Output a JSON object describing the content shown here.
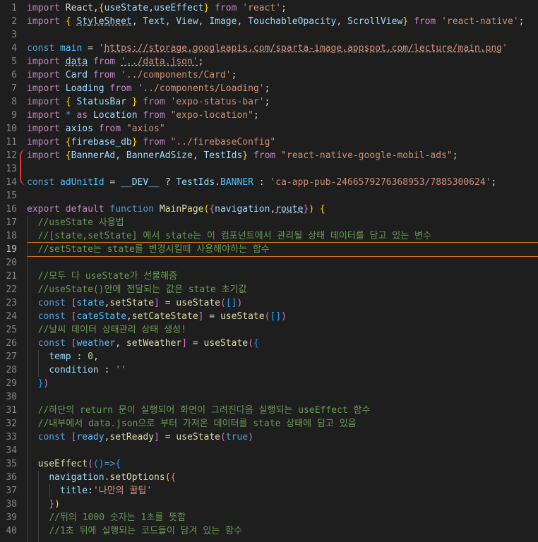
{
  "editor": {
    "current_line": 19,
    "colors": {
      "background": "#1e1e1e",
      "current_line_border": "#d8761c",
      "diff_marker": "#e0393e"
    },
    "lines": [
      {
        "n": 1,
        "t": [
          [
            "kw",
            "import"
          ],
          [
            "p",
            " React,"
          ],
          [
            "b1",
            "{"
          ],
          [
            "var",
            "useState"
          ],
          [
            "p",
            ","
          ],
          [
            "var",
            "useEffect"
          ],
          [
            "b1",
            "}"
          ],
          [
            "p",
            " "
          ],
          [
            "kw",
            "from"
          ],
          [
            "p",
            " "
          ],
          [
            "str",
            "'react'"
          ],
          [
            "p",
            ";"
          ]
        ]
      },
      {
        "n": 2,
        "t": [
          [
            "kw",
            "import"
          ],
          [
            "p",
            " "
          ],
          [
            "b1",
            "{"
          ],
          [
            "p",
            " "
          ],
          [
            "varu",
            "StyleSheet"
          ],
          [
            "p",
            ", "
          ],
          [
            "var",
            "Text"
          ],
          [
            "p",
            ", "
          ],
          [
            "var",
            "View"
          ],
          [
            "p",
            ", "
          ],
          [
            "var",
            "Image"
          ],
          [
            "p",
            ", "
          ],
          [
            "var",
            "TouchableOpacity"
          ],
          [
            "p",
            ", "
          ],
          [
            "var",
            "ScrollView"
          ],
          [
            "b1",
            "}"
          ],
          [
            "p",
            " "
          ],
          [
            "kw",
            "from"
          ],
          [
            "p",
            " "
          ],
          [
            "str",
            "'react-native'"
          ],
          [
            "p",
            ";"
          ]
        ]
      },
      {
        "n": 3,
        "t": []
      },
      {
        "n": 4,
        "t": [
          [
            "kw2",
            "const"
          ],
          [
            "p",
            " "
          ],
          [
            "const",
            "main"
          ],
          [
            "p",
            " = "
          ],
          [
            "str",
            "'"
          ],
          [
            "stru",
            "https://storage.googleapis.com/sparta-image.appspot.com/lecture/main.png"
          ],
          [
            "str",
            "'"
          ]
        ]
      },
      {
        "n": 5,
        "t": [
          [
            "kw",
            "import"
          ],
          [
            "p",
            " "
          ],
          [
            "varu",
            "data"
          ],
          [
            "p",
            " "
          ],
          [
            "kw",
            "from"
          ],
          [
            "p",
            " "
          ],
          [
            "stru",
            "'../data.json'"
          ],
          [
            "p",
            ";"
          ]
        ]
      },
      {
        "n": 6,
        "t": [
          [
            "kw",
            "import"
          ],
          [
            "p",
            " "
          ],
          [
            "var",
            "Card"
          ],
          [
            "p",
            " "
          ],
          [
            "kw",
            "from"
          ],
          [
            "p",
            " "
          ],
          [
            "str",
            "'../components/Card'"
          ],
          [
            "p",
            ";"
          ]
        ]
      },
      {
        "n": 7,
        "t": [
          [
            "kw",
            "import"
          ],
          [
            "p",
            " "
          ],
          [
            "var",
            "Loading"
          ],
          [
            "p",
            " "
          ],
          [
            "kw",
            "from"
          ],
          [
            "p",
            " "
          ],
          [
            "str",
            "'../components/Loading'"
          ],
          [
            "p",
            ";"
          ]
        ]
      },
      {
        "n": 8,
        "t": [
          [
            "kw",
            "import"
          ],
          [
            "p",
            " "
          ],
          [
            "b1",
            "{"
          ],
          [
            "p",
            " "
          ],
          [
            "var",
            "StatusBar"
          ],
          [
            "p",
            " "
          ],
          [
            "b1",
            "}"
          ],
          [
            "p",
            " "
          ],
          [
            "kw",
            "from"
          ],
          [
            "p",
            " "
          ],
          [
            "str",
            "'expo-status-bar'"
          ],
          [
            "p",
            ";"
          ]
        ]
      },
      {
        "n": 9,
        "t": [
          [
            "kw",
            "import"
          ],
          [
            "p",
            " "
          ],
          [
            "kw2",
            "*"
          ],
          [
            "p",
            " "
          ],
          [
            "kw",
            "as"
          ],
          [
            "p",
            " "
          ],
          [
            "var",
            "Location"
          ],
          [
            "p",
            " "
          ],
          [
            "kw",
            "from"
          ],
          [
            "p",
            " "
          ],
          [
            "str",
            "\"expo-location\""
          ],
          [
            "p",
            ";"
          ]
        ]
      },
      {
        "n": 10,
        "t": [
          [
            "kw",
            "import"
          ],
          [
            "p",
            " "
          ],
          [
            "var",
            "axios"
          ],
          [
            "p",
            " "
          ],
          [
            "kw",
            "from"
          ],
          [
            "p",
            " "
          ],
          [
            "str",
            "\"axios\""
          ]
        ]
      },
      {
        "n": 11,
        "t": [
          [
            "kw",
            "import"
          ],
          [
            "p",
            " "
          ],
          [
            "b1",
            "{"
          ],
          [
            "var",
            "firebase_db"
          ],
          [
            "b1",
            "}"
          ],
          [
            "p",
            " "
          ],
          [
            "kw",
            "from"
          ],
          [
            "p",
            " "
          ],
          [
            "str",
            "\"../firebaseConfig\""
          ]
        ]
      },
      {
        "n": 12,
        "t": [
          [
            "kw",
            "import"
          ],
          [
            "p",
            " "
          ],
          [
            "b1",
            "{"
          ],
          [
            "var",
            "BannerAd"
          ],
          [
            "p",
            ", "
          ],
          [
            "var",
            "BannerAdSize"
          ],
          [
            "p",
            ", "
          ],
          [
            "var",
            "TestIds"
          ],
          [
            "b1",
            "}"
          ],
          [
            "p",
            " "
          ],
          [
            "kw",
            "from"
          ],
          [
            "p",
            " "
          ],
          [
            "str",
            "\"react-native-google-mobil-ads\""
          ],
          [
            "p",
            ";"
          ]
        ]
      },
      {
        "n": 13,
        "t": []
      },
      {
        "n": 14,
        "t": [
          [
            "kw2",
            "const"
          ],
          [
            "p",
            " "
          ],
          [
            "const",
            "adUnitId"
          ],
          [
            "p",
            " = "
          ],
          [
            "var",
            "__DEV__"
          ],
          [
            "p",
            " ? "
          ],
          [
            "var",
            "TestIds"
          ],
          [
            "p",
            "."
          ],
          [
            "const",
            "BANNER"
          ],
          [
            "p",
            " : "
          ],
          [
            "str",
            "'ca-app-pub-2466579276368953/7885300624'"
          ],
          [
            "p",
            ";"
          ]
        ]
      },
      {
        "n": 15,
        "t": []
      },
      {
        "n": 16,
        "t": [
          [
            "kw",
            "export"
          ],
          [
            "p",
            " "
          ],
          [
            "kw",
            "default"
          ],
          [
            "p",
            " "
          ],
          [
            "kw2",
            "function"
          ],
          [
            "p",
            " "
          ],
          [
            "fn",
            "MainPage"
          ],
          [
            "b1",
            "("
          ],
          [
            "b2",
            "{"
          ],
          [
            "var",
            "navigation"
          ],
          [
            "p",
            ","
          ],
          [
            "varu",
            "route"
          ],
          [
            "b2",
            "}"
          ],
          [
            "b1",
            ")"
          ],
          [
            "p",
            " "
          ],
          [
            "b1",
            "{"
          ]
        ]
      },
      {
        "n": 17,
        "t": [
          [
            "p",
            "  "
          ],
          [
            "cmt",
            "//useState 사용법"
          ]
        ]
      },
      {
        "n": 18,
        "t": [
          [
            "p",
            "  "
          ],
          [
            "cmt",
            "//[state,setState] 에서 state는 이 컴포넌트에서 관리될 상태 데이터를 담고 있는 변수"
          ]
        ]
      },
      {
        "n": 19,
        "t": [
          [
            "p",
            "  "
          ],
          [
            "cmt",
            "//setState는 state를 변경시킬때 사용해야하는 함수"
          ]
        ]
      },
      {
        "n": 20,
        "t": []
      },
      {
        "n": 21,
        "t": [
          [
            "p",
            "  "
          ],
          [
            "cmt",
            "//모두 다 useState가 선물해줌"
          ]
        ]
      },
      {
        "n": 22,
        "t": [
          [
            "p",
            "  "
          ],
          [
            "cmt",
            "//useState()안에 전달되는 값은 state 초기값"
          ]
        ]
      },
      {
        "n": 23,
        "t": [
          [
            "p",
            "  "
          ],
          [
            "kw2",
            "const"
          ],
          [
            "p",
            " "
          ],
          [
            "b2",
            "["
          ],
          [
            "const",
            "state"
          ],
          [
            "p",
            ","
          ],
          [
            "fn",
            "setState"
          ],
          [
            "b2",
            "]"
          ],
          [
            "p",
            " = "
          ],
          [
            "fn",
            "useState"
          ],
          [
            "b2",
            "("
          ],
          [
            "b3",
            "[]"
          ],
          [
            "b2",
            ")"
          ]
        ]
      },
      {
        "n": 24,
        "t": [
          [
            "p",
            "  "
          ],
          [
            "kw2",
            "const"
          ],
          [
            "p",
            " "
          ],
          [
            "b2",
            "["
          ],
          [
            "const",
            "cateState"
          ],
          [
            "p",
            ","
          ],
          [
            "fn",
            "setCateState"
          ],
          [
            "b2",
            "]"
          ],
          [
            "p",
            " = "
          ],
          [
            "fn",
            "useState"
          ],
          [
            "b2",
            "("
          ],
          [
            "b3",
            "[]"
          ],
          [
            "b2",
            ")"
          ]
        ]
      },
      {
        "n": 25,
        "t": [
          [
            "p",
            "  "
          ],
          [
            "cmt",
            "//날씨 데이터 상태관리 상태 생성!"
          ]
        ]
      },
      {
        "n": 26,
        "t": [
          [
            "p",
            "  "
          ],
          [
            "kw2",
            "const"
          ],
          [
            "p",
            " "
          ],
          [
            "b2",
            "["
          ],
          [
            "const",
            "weather"
          ],
          [
            "p",
            ", "
          ],
          [
            "fn",
            "setWeather"
          ],
          [
            "b2",
            "]"
          ],
          [
            "p",
            " = "
          ],
          [
            "fn",
            "useState"
          ],
          [
            "b2",
            "("
          ],
          [
            "b3",
            "{"
          ]
        ]
      },
      {
        "n": 27,
        "t": [
          [
            "p",
            "    "
          ],
          [
            "var",
            "temp"
          ],
          [
            "p",
            " : "
          ],
          [
            "num",
            "0"
          ],
          [
            "p",
            ","
          ]
        ]
      },
      {
        "n": 28,
        "t": [
          [
            "p",
            "    "
          ],
          [
            "var",
            "condition"
          ],
          [
            "p",
            " : "
          ],
          [
            "str",
            "''"
          ]
        ]
      },
      {
        "n": 29,
        "t": [
          [
            "p",
            "  "
          ],
          [
            "b3",
            "}"
          ],
          [
            "b2",
            ")"
          ]
        ]
      },
      {
        "n": 30,
        "t": []
      },
      {
        "n": 31,
        "t": [
          [
            "p",
            "  "
          ],
          [
            "cmt",
            "//하단의 return 문이 실행되어 화면이 그려진다음 실행되는 useEffect 함수"
          ]
        ]
      },
      {
        "n": 32,
        "t": [
          [
            "p",
            "  "
          ],
          [
            "cmt",
            "//내부에서 data.json으로 부터 가져온 데이터를 state 상태에 담고 있음"
          ]
        ]
      },
      {
        "n": 33,
        "t": [
          [
            "p",
            "  "
          ],
          [
            "kw2",
            "const"
          ],
          [
            "p",
            " "
          ],
          [
            "b2",
            "["
          ],
          [
            "const",
            "ready"
          ],
          [
            "p",
            ","
          ],
          [
            "fn",
            "setReady"
          ],
          [
            "b2",
            "]"
          ],
          [
            "p",
            " = "
          ],
          [
            "fn",
            "useState"
          ],
          [
            "b2",
            "("
          ],
          [
            "kw2",
            "true"
          ],
          [
            "b2",
            ")"
          ]
        ]
      },
      {
        "n": 34,
        "t": []
      },
      {
        "n": 35,
        "t": [
          [
            "p",
            "  "
          ],
          [
            "fn",
            "useEffect"
          ],
          [
            "b2",
            "("
          ],
          [
            "b3",
            "()"
          ],
          [
            "kw2",
            "=>"
          ],
          [
            "b3",
            "{"
          ]
        ]
      },
      {
        "n": 36,
        "t": [
          [
            "p",
            "    "
          ],
          [
            "var",
            "navigation"
          ],
          [
            "p",
            "."
          ],
          [
            "fn",
            "setOptions"
          ],
          [
            "b1",
            "("
          ],
          [
            "b2",
            "{"
          ]
        ]
      },
      {
        "n": 37,
        "t": [
          [
            "p",
            "      "
          ],
          [
            "var",
            "title"
          ],
          [
            "p",
            ":"
          ],
          [
            "str",
            "'나만의 꿀팁'"
          ]
        ]
      },
      {
        "n": 38,
        "t": [
          [
            "p",
            "    "
          ],
          [
            "b2",
            "}"
          ],
          [
            "b1",
            ")"
          ]
        ]
      },
      {
        "n": 39,
        "t": [
          [
            "p",
            "    "
          ],
          [
            "cmt",
            "//뒤의 1000 숫자는 1초를 뜻함"
          ]
        ]
      },
      {
        "n": 40,
        "t": [
          [
            "p",
            "    "
          ],
          [
            "cmt",
            "//1초 뒤에 실행되는 코드들이 담겨 있는 함수"
          ]
        ]
      }
    ]
  }
}
